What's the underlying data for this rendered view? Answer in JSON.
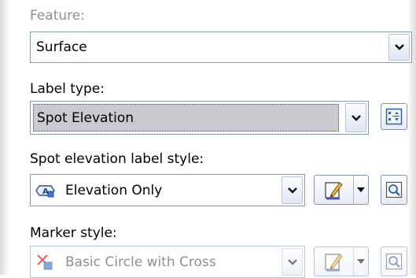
{
  "feature": {
    "label": "Feature:",
    "value": "Surface"
  },
  "label_type": {
    "label": "Label type:",
    "value": "Spot Elevation"
  },
  "spot_style": {
    "label": "Spot elevation label style:",
    "value": "Elevation Only"
  },
  "marker_style": {
    "label": "Marker style:",
    "value": "Basic Circle with Cross"
  },
  "icons": {
    "label_type_button": "grid-settings-icon",
    "edit_buttons": "pencil-edit-icon",
    "preview_buttons": "magnifier-icon",
    "spot_style_icon": "label-style-icon",
    "marker_style_icon": "marker-style-icon"
  },
  "colors": {
    "combo_border": "#7f9db9",
    "selected_background": "#c9c9cf",
    "faded_text": "#8f8f8f"
  }
}
